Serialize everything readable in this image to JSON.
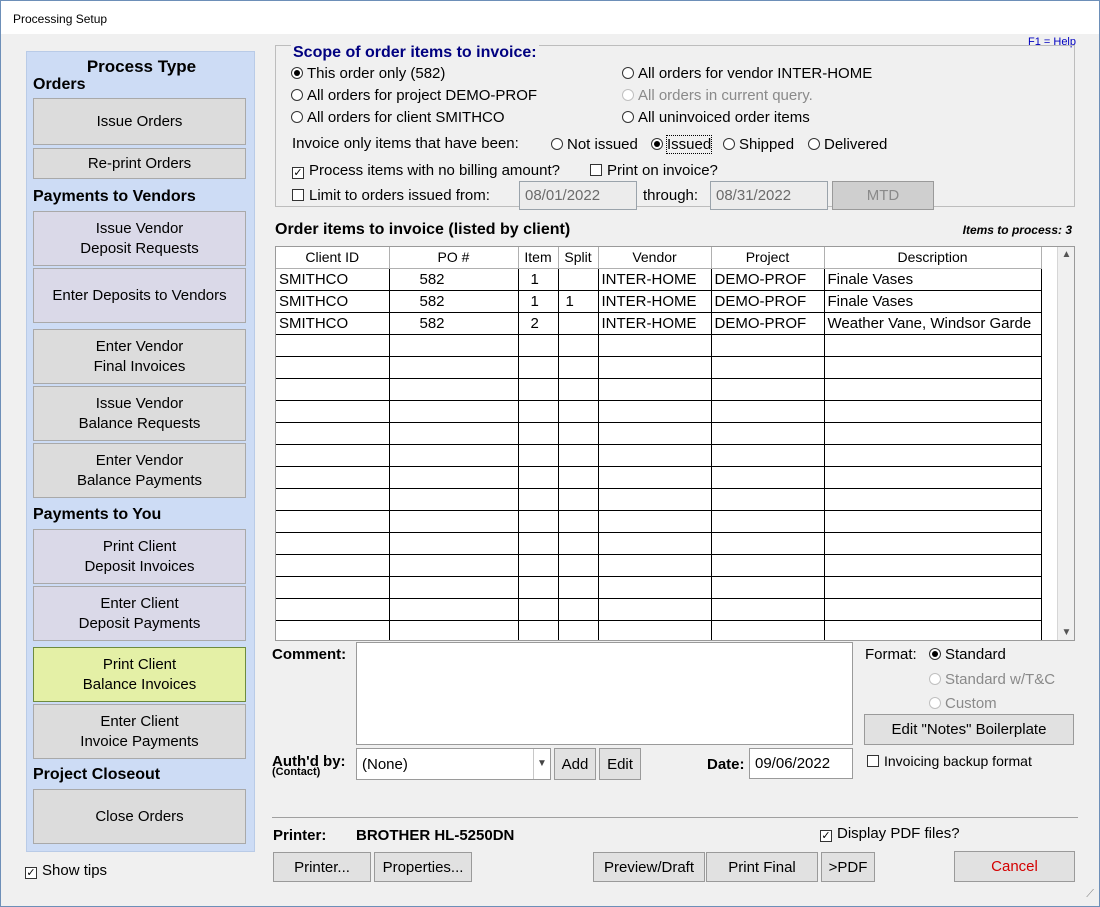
{
  "window": {
    "title": "Processing Setup",
    "help": "F1 = Help"
  },
  "left": {
    "process_type": "Process Type",
    "orders_heading": "Orders",
    "issue_orders": "Issue Orders",
    "reprint_orders": "Re-print Orders",
    "vendors_heading": "Payments to Vendors",
    "issue_vendor_deposit": [
      "Issue Vendor",
      "Deposit Requests"
    ],
    "enter_deposits_vendors": "Enter Deposits to Vendors",
    "enter_vendor_final": [
      "Enter Vendor",
      "Final Invoices"
    ],
    "issue_vendor_balance": [
      "Issue Vendor",
      "Balance Requests"
    ],
    "enter_vendor_balance": [
      "Enter Vendor",
      "Balance Payments"
    ],
    "you_heading": "Payments to You",
    "print_client_deposit": [
      "Print Client",
      "Deposit Invoices"
    ],
    "enter_client_deposit": [
      "Enter Client",
      "Deposit Payments"
    ],
    "print_client_balance": [
      "Print Client",
      "Balance Invoices"
    ],
    "enter_client_invoice": [
      "Enter Client",
      "Invoice Payments"
    ],
    "closeout_heading": "Project Closeout",
    "close_orders": "Close Orders",
    "show_tips": "Show tips"
  },
  "scope": {
    "title": "Scope of order items to invoice:",
    "this_order": "This order only (582)",
    "all_project": "All orders for project DEMO-PROF",
    "all_client": "All orders for client SMITHCO",
    "all_vendor": "All orders for vendor INTER-HOME",
    "all_query": "All orders in current query.",
    "all_uninvoiced": "All uninvoiced order items",
    "invoice_only_label": "Invoice only items that have been:",
    "not_issued": "Not issued",
    "issued": "Issued",
    "shipped": "Shipped",
    "delivered": "Delivered",
    "no_billing": "Process items with no billing amount?",
    "print_on_invoice": "Print on invoice?",
    "limit_orders": "Limit to orders issued from:",
    "date_from": "08/01/2022",
    "through": "through:",
    "date_to": "08/31/2022",
    "mtd": "MTD"
  },
  "grid": {
    "title": "Order items to invoice (listed by client)",
    "items_count": "Items to process: 3",
    "columns": [
      "Client ID",
      "PO #",
      "Item",
      "Split",
      "Vendor",
      "Project",
      "Description"
    ],
    "rows": [
      [
        "SMITHCO",
        "582",
        "1",
        "",
        "INTER-HOME",
        "DEMO-PROF",
        "Finale Vases"
      ],
      [
        "SMITHCO",
        "582",
        "1",
        "1",
        "INTER-HOME",
        "DEMO-PROF",
        "Finale Vases"
      ],
      [
        "SMITHCO",
        "582",
        "2",
        "",
        "INTER-HOME",
        "DEMO-PROF",
        "Weather Vane, Windsor Garde"
      ]
    ]
  },
  "bottom": {
    "comment": "Comment:",
    "format": "Format:",
    "standard": "Standard",
    "standard_tc": "Standard w/T&C",
    "custom": "Custom",
    "edit_notes": "Edit \"Notes\" Boilerplate",
    "backup_format": "Invoicing backup format",
    "authd_by": "Auth'd by:",
    "contact": "(Contact)",
    "auth_value": "(None)",
    "add": "Add",
    "edit": "Edit",
    "date_label": "Date:",
    "date_value": "09/06/2022",
    "printer_label": "Printer:",
    "printer_value": "BROTHER HL-5250DN",
    "display_pdf": "Display PDF files?",
    "printer_btn": "Printer...",
    "properties_btn": "Properties...",
    "preview_btn": "Preview/Draft",
    "print_final_btn": "Print Final",
    "pdf_btn": ">PDF",
    "cancel_btn": "Cancel",
    "cancel_color": "#d40000"
  }
}
